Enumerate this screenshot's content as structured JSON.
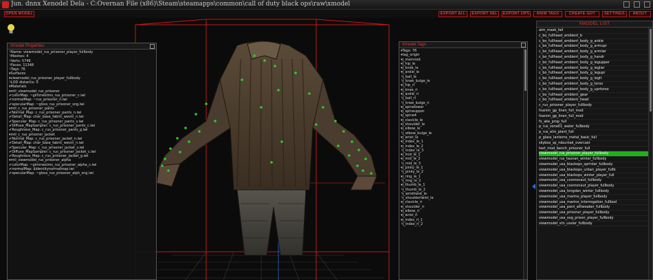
{
  "window": {
    "title": "Jun. dnnx Xenodel Dela - C:Overnan File (x86)\\Steam\\steamapps\\common\\call of duty black ops\\raw\\xmodel"
  },
  "toolbar": {
    "open_label": "OPEN MODEL",
    "buttons": [
      "EXPORT ALL",
      "EXPORT SEL",
      "EXPORT OPS",
      "ANIM TAGS",
      "CREATE GDT",
      "SETTINGS",
      "ABOUT"
    ]
  },
  "properties_panel": {
    "title": "Xmodel Properties",
    "rows": [
      "└Name: viewmodel_rus_prisoner_player_fullbody",
      "└Meshes: 4",
      "└Verts: 5746",
      "└Faces: 11348",
      "└Tags: 76",
      "▾Surfaces",
      "  ▾viewmodel_rus_prisoner_player_fullbody",
      "    └LOD distance: 0",
      "    ▾Materials",
      "      ▾mtl_viewmodel_rus_prisoner",
      "        ✔colorMap: ~gimmestms_rus_prisoner_c.iwi",
      "        ✔normalMap: ~rus_prisoner_n.iwi",
      "        ✔specularMap: ~gloss_rus_prisoner_sng.iwi",
      "      ▾mtl_c_rus_prisoner_pants",
      "        ✔Normal_Map: c_rus_prisoner_pants_n.iwi",
      "        ✔Detail_Map: char_base_fabric_wevin_n.iwi",
      "        ✔Specular_Map: c_rus_prisoner_pants_s.iwi",
      "        ✔Diffuse_MapSampler: c_rus_prisoner_pants_c.iwi",
      "        ✔Roughness_Map: c_rus_prisoner_pants_g.iwi",
      "      ▾mtl_c_rus_prisoner_jacket",
      "        ✔Normal_Map: c_rus_prisoner_jacket_n.iwi",
      "        ✔Detail_Map: char_base_fabric_wevin_n.iwi",
      "        ✔Specular_Map: c_rus_prisoner_jacket_s.iwi",
      "        ✔Diffuse_MapSampler: c_rus_prisoner_jacket_c.iwi",
      "        ✔Roughness_Map: c_rus_prisoner_jacket_g.iwi",
      "      ▾mtl_viewmodel_rus_prisoner_alpha",
      "        ✔colorMap: ~gimmestms_rus_prisoner_alpha_c.iwi",
      "        ✔normalMap: $identitynormalmap.iwi",
      "        ✔specularMap: ~gloss_rus_prisoner_alph_sng.iwi"
    ]
  },
  "tags_panel": {
    "title": "Xmodel Tags",
    "rows": [
      "▾Tags: 76",
      " ▾tag_origin",
      "  ▾j_mainroot",
      "   ▾j_hip_le",
      "    ▾j_knee_le",
      "     ▾j_ankle_le",
      "      └j_ball_le",
      "     └j_knee_bulge_le",
      "   ▾j_hip_ri",
      "    ▾j_knee_ri",
      "     ▾j_ankle_ri",
      "      └j_ball_ri",
      "     └j_knee_bulge_ri",
      "   ▾j_spinelower",
      "    ▾j_spineupper",
      "     ▾j_spine4",
      "      ▾j_clavicle_le",
      "       ▾j_shoulder_le",
      "        ▾j_elbow_le",
      "         └j_elbow_bulge_le",
      "         ▾j_wrist_le",
      "          ▾j_index_le_1",
      "           ▾j_index_le_2",
      "            └j_index_le_3",
      "          ▾j_mid_le_1",
      "           ▾j_mid_le_2",
      "            └j_mid_le_3",
      "          ▾j_pinky_le_1",
      "           └j_pinky_le_2",
      "          ▾j_ring_le_1",
      "           └j_ring_le_2",
      "          ▾j_thumb_le_1",
      "           └j_thumb_le_2",
      "          └j_wristtwist_le",
      "         └j_shouldertwist_le",
      "       ▾j_clavicle_ri",
      "        ▾j_shoulder_ri",
      "         ▾j_elbow_ri",
      "          ▾j_wrist_ri",
      "           ▾j_index_ri_1",
      "            └j_index_ri_2"
    ]
  },
  "model_list": {
    "title": "XMODEL LIST",
    "items": [
      "aim_mask_fall",
      "c_bo_fullhead_ambient_b",
      "c_bo_fullhead_ambient_body_g_ankle",
      "c_bo_fullhead_ambient_body_g_armupr",
      "c_bo_fullhead_ambient_body_g_armlwr",
      "c_bo_fullhead_ambient_body_g_handr",
      "c_bo_fullhead_ambient_body_g_legupper",
      "c_bo_fullhead_ambient_body_g_leglwr",
      "c_bo_fullhead_ambient_body_g_legupr",
      "c_bo_fullhead_ambient_body_g_leglt",
      "c_bo_fullhead_ambient_body_g_torso",
      "c_bo_fullhead_ambient_body_g_uprtorso",
      "c_bo_fullhead_ambient_gear",
      "c_bo_fullhead_ambient_head",
      "c_rus_prisoner_player_fullbody",
      "fxanim_gp_linen_full_mod",
      "fxanim_gp_linen_full_mod",
      "fx_ake_prop_full",
      "p_rus_zone01_water_fullbody",
      "p_rus_elm_plant_full",
      "p_glass_lanterns_metal_basic_full",
      "skybox_sp_robuntak_overcast",
      "test_mod_bench_prisoner_full",
      "viewmodel_rus_prisoner_player_fullbody",
      "viewmodel_rus_taunan_winter_fullbody",
      "viewmodel_usa_blackops_sprinter_fullbody",
      "viewmodel_usa_blackops_urban_player_fullb",
      "viewmodel_usa_blackops_winter_player_full",
      "viewmodel_usa_cosmonaut_fullbody",
      "viewmodel_usa_cosmonaut_player_fullbody",
      "viewmodel_usa_longdan_winter_fullbody",
      "viewmodel_usa_marine_player_fullbody",
      "viewmodel_usa_marine_interrogation_fullbod",
      "viewmodel_usa_pent_alltweaker_fullbody",
      "viewmodel_usa_prisoner_player_fullbody",
      "viewmodel_usa_sog_prison_player_fullbody",
      "viewmodel_vtn_ussier_fullbody"
    ],
    "selected_index": 23
  }
}
